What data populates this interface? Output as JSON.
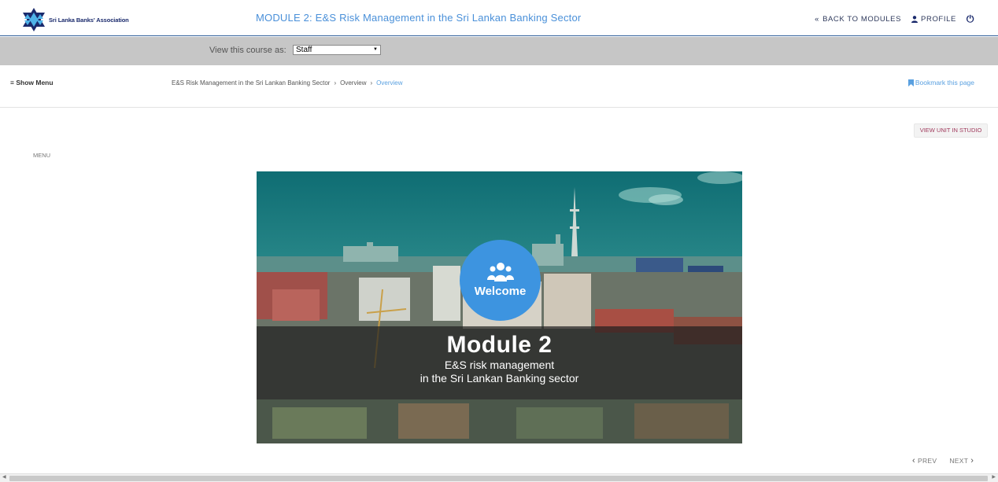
{
  "header": {
    "logo_text": "Sri Lanka Banks' Association",
    "module_title": "MODULE 2: E&S Risk Management in the Sri Lankan Banking Sector",
    "back_to_modules": "BACK TO MODULES",
    "profile": "PROFILE"
  },
  "view_as": {
    "label": "View this course as:",
    "selected": "Staff"
  },
  "course_nav": {
    "show_menu": "Show Menu",
    "breadcrumb": [
      "E&S Risk Management in the Sri Lankan Banking Sector",
      "Overview",
      "Overview"
    ],
    "bookmark": "Bookmark this page"
  },
  "content": {
    "studio_button": "VIEW UNIT IN STUDIO",
    "menu_label": "MENU",
    "welcome": "Welcome",
    "hero_title": "Module 2",
    "hero_sub1": "E&S risk management",
    "hero_sub2": "in the Sri Lankan Banking sector"
  },
  "pager": {
    "prev": "PREV",
    "next": "NEXT"
  },
  "colors": {
    "accent": "#4a90d9",
    "link": "#5aa0e0",
    "brand": "#1a2a6c",
    "circle": "#3d94e0",
    "studio_text": "#a0395c"
  }
}
